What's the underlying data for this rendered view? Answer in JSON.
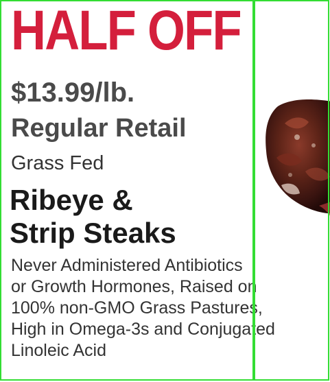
{
  "ad": {
    "headline": "HALF OFF",
    "price": "$13.99/lb.",
    "price_note": "Regular Retail",
    "qualifier": "Grass Fed",
    "product_lines": [
      "Ribeye &",
      "Strip Steaks"
    ],
    "description_lines": [
      "Never Administered Antibiotics",
      "or Growth Hormones, Raised on",
      "100% non-GMO Grass Pastures,",
      "High in Omega-3s and Conjugated",
      "Linoleic Acid"
    ],
    "image": "grilled-steak-photo"
  },
  "colors": {
    "headline": "#d41f3c",
    "price_text": "#4a4a4a",
    "body_text": "#333333",
    "frame": "#33dd33"
  }
}
